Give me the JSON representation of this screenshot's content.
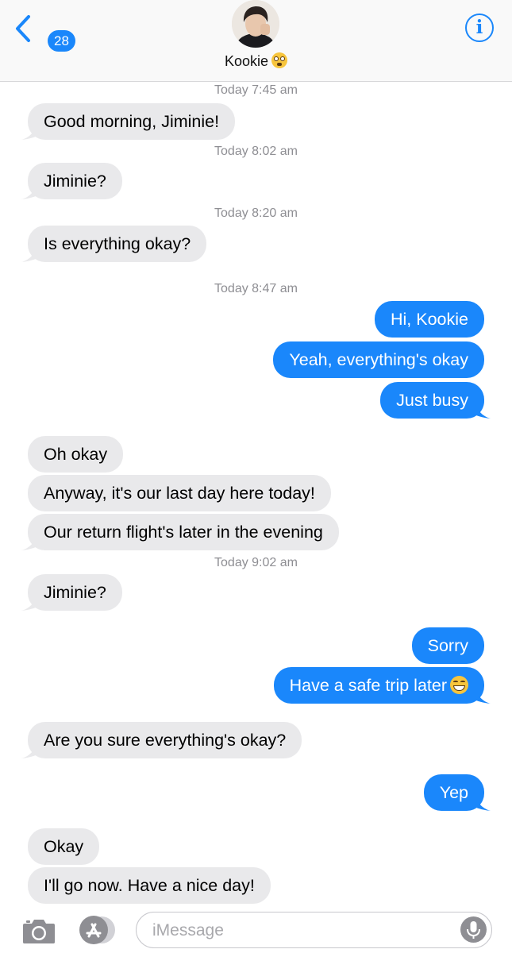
{
  "header": {
    "back_count": "28",
    "contact_name": "Kookie",
    "contact_emoji": "flushed-face-emoji",
    "accent_color": "#1a87fb"
  },
  "messages": [
    {
      "type": "timestamp",
      "text": "Today 7:45 am"
    },
    {
      "type": "in",
      "text": "Good morning, Jiminie!"
    },
    {
      "type": "timestamp",
      "text": "Today 8:02 am"
    },
    {
      "type": "in",
      "text": "Jiminie?"
    },
    {
      "type": "timestamp",
      "text": "Today 8:20 am"
    },
    {
      "type": "in",
      "text": "Is everything okay?"
    },
    {
      "type": "timestamp",
      "text": "Today 8:47 am"
    },
    {
      "type": "out",
      "text": "Hi, Kookie"
    },
    {
      "type": "out",
      "text": "Yeah, everything's okay"
    },
    {
      "type": "out",
      "text": "Just busy"
    },
    {
      "type": "in",
      "text": "Oh okay"
    },
    {
      "type": "in",
      "text": "Anyway, it's our last day here today!"
    },
    {
      "type": "in",
      "text": "Our return flight's later in the evening"
    },
    {
      "type": "timestamp",
      "text": "Today 9:02 am"
    },
    {
      "type": "in",
      "text": "Jiminie?"
    },
    {
      "type": "out",
      "text": "Sorry"
    },
    {
      "type": "out",
      "text": "Have a safe trip later",
      "emoji": "grinning-face-emoji"
    },
    {
      "type": "in",
      "text": "Are you sure everything's okay?"
    },
    {
      "type": "out",
      "text": "Yep"
    },
    {
      "type": "in",
      "text": "Okay"
    },
    {
      "type": "in",
      "text": "I'll go now. Have a nice day!"
    }
  ],
  "composer": {
    "placeholder": "iMessage",
    "icons": [
      "camera-icon",
      "app-store-icon",
      "microphone-icon"
    ]
  },
  "colors": {
    "incoming_bubble": "#e9e9eb",
    "outgoing_bubble": "#1a87fb",
    "timestamp": "#8e8e93"
  }
}
